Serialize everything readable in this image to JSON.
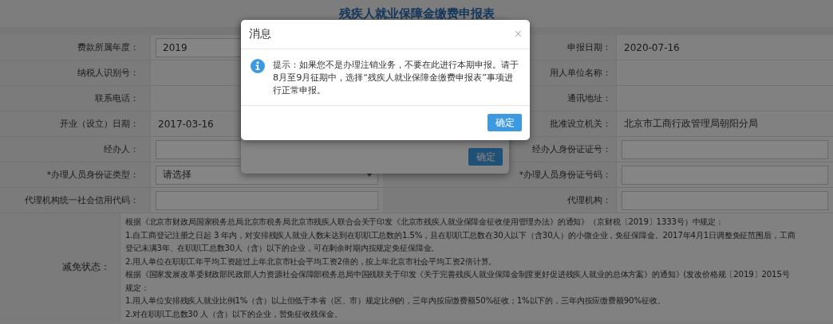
{
  "page": {
    "title": "残疾人就业保障金缴费申报表"
  },
  "form": {
    "rows": [
      {
        "left": {
          "label": "费款所属年度：",
          "kind": "input",
          "value": "2019"
        },
        "right": {
          "label": "申报日期：",
          "kind": "text",
          "value": "2020-07-16"
        }
      },
      {
        "left": {
          "label": "纳税人识别号：",
          "kind": "text"
        },
        "right": {
          "label": "用人单位名称：",
          "kind": "text"
        }
      },
      {
        "left": {
          "label": "联系电话：",
          "kind": "text"
        },
        "right": {
          "label": "通讯地址：",
          "kind": "text"
        }
      },
      {
        "left": {
          "label": "开业（设立）日期：",
          "kind": "text",
          "value": "2017-03-16"
        },
        "right": {
          "label": "批准设立机关：",
          "kind": "text",
          "value": "北京市工商行政管理局朝阳分局"
        }
      },
      {
        "left": {
          "label": "经办人：",
          "kind": "input"
        },
        "right": {
          "label": "经办人身份证证号：",
          "kind": "input"
        }
      },
      {
        "left": {
          "label": "*办理人员身份证类型：",
          "kind": "select",
          "value": "请选择"
        },
        "right": {
          "label": "*办理人员身份证号码：",
          "kind": "input"
        }
      },
      {
        "left": {
          "label": "代理机构统一社会信用代码：",
          "kind": "input"
        },
        "right": {
          "label": "代理机构：",
          "kind": "input"
        }
      }
    ]
  },
  "exemption": {
    "label": "减免状态：",
    "lines": [
      "根据《北京市财政局国家税务总局北京市税务局北京市残疾人联合会关于印发《北京市残疾人就业保障金征收使用管理办法》的通知》（京财税〔2019〕1333号）中规定：",
      "1.自工商登记注册之日起 3 年内，对安排残疾人就业人数未达到在职职工总数的1.5%，且在职职工总数在30人以下（含30人）的小微企业，免征保障金。2017年4月1日调整免征范围后，工商",
      "登记未满3年、在职职工总数30人（含）以下的企业，可在剩余时期内按规定免征保障金。",
      "2.用人单位在职职工年平均工资超过上年北京市社会平均工资2倍的，按上年北京市社会平均工资2倍计算。",
      "根据《国家发展改革委财政部民政部人力资源社会保障部税务总局中国残联关于印发《关于完善残疾人就业保障金制度更好促进残疾人就业的总体方案》的通知》(发改价格规〔2019〕2015号",
      "规定：",
      "1.用人单位安排残疾人就业比例1%（含）以上但低于本省（区、市）规定比例的，三年内按应缴费额50%征收；1%以下的，三年内按应缴费额90%征收。",
      "2.对在职职工总数30 人（含）以下的企业，暂免征收残保金。"
    ]
  },
  "background_dialog": {
    "button": "确定"
  },
  "dialog": {
    "title": "消息",
    "close": "×",
    "message": "提示：如果您不是办理注销业务，不要在此进行本期申报。请于8月至9月征期中，选择“残疾人就业保障金缴费申报表”事项进行正常申报。",
    "button": "确定"
  }
}
